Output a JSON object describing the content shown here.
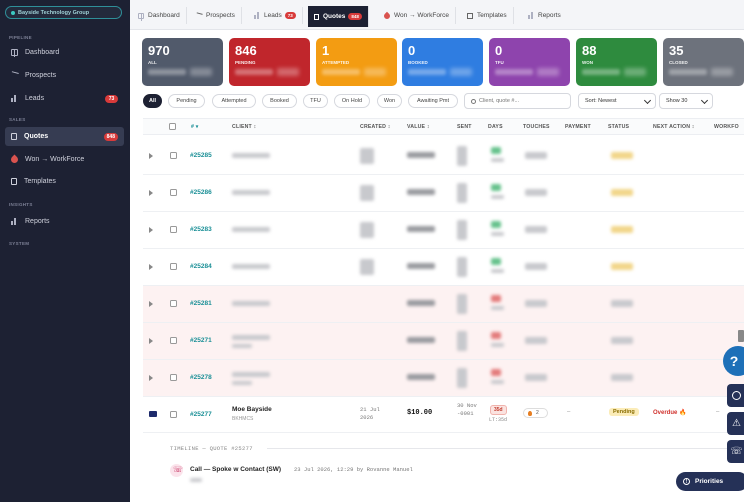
{
  "sidebar": {
    "org": "Bayside Technology Group",
    "sections": {
      "pipeline": "PIPELINE",
      "sales": "SALES",
      "insights": "INSIGHTS",
      "system": "SYSTEM"
    },
    "items": [
      {
        "label": "Dashboard",
        "icon": "grid-icon"
      },
      {
        "label": "Prospects",
        "icon": "prospect-icon"
      },
      {
        "label": "Leads",
        "icon": "leads-icon",
        "badge": "73"
      },
      {
        "label": "Quotes",
        "icon": "document-icon",
        "badge": "848"
      },
      {
        "label": "Won → WorkForce",
        "icon": "rocket-icon"
      },
      {
        "label": "Templates",
        "icon": "template-icon"
      },
      {
        "label": "Reports",
        "icon": "bar-chart-icon"
      }
    ]
  },
  "tabs": [
    {
      "label": "Dashboard"
    },
    {
      "label": "Prospects"
    },
    {
      "label": "Leads",
      "badge": "73"
    },
    {
      "label": "Quotes",
      "badge": "848"
    },
    {
      "label": "Won → WorkForce"
    },
    {
      "label": "Templates"
    },
    {
      "label": "Reports"
    }
  ],
  "stats": [
    {
      "value": "970",
      "label": "ALL",
      "color": "#515a6b"
    },
    {
      "value": "846",
      "label": "PENDING",
      "color": "#c0262c"
    },
    {
      "value": "1",
      "label": "ATTEMPTED",
      "color": "#f39c12"
    },
    {
      "value": "0",
      "label": "BOOKED",
      "color": "#2f7de1"
    },
    {
      "value": "0",
      "label": "TFU",
      "color": "#8e44ad"
    },
    {
      "value": "88",
      "label": "WON",
      "color": "#2e8b3e"
    },
    {
      "value": "35",
      "label": "CLOSED",
      "color": "#6d727c"
    }
  ],
  "filters": [
    "All",
    "Pending",
    "Attempted",
    "Booked",
    "TFU",
    "On Hold",
    "Won",
    "Awaiting Pmt"
  ],
  "search": {
    "placeholder": "Client, quote #..."
  },
  "sort": {
    "value": "Sort: Newest"
  },
  "show": {
    "value": "Show 30"
  },
  "table": {
    "headers": [
      "# ▾",
      "CLIENT ↕",
      "CREATED ↕",
      "VALUE ↕",
      "SENT",
      "DAYS",
      "TOUCHES",
      "PAYMENT",
      "STATUS",
      "NEXT ACTION ↕",
      "WORKFO"
    ],
    "rows": [
      {
        "id": "#25285"
      },
      {
        "id": "#25286"
      },
      {
        "id": "#25283"
      },
      {
        "id": "#25284"
      },
      {
        "id": "#25281"
      },
      {
        "id": "#25271"
      },
      {
        "id": "#25278"
      }
    ],
    "expanded": {
      "id": "#25277",
      "client": "Moe Bayside",
      "client_sub": "BKHMCS",
      "created": "21 Jul 2026",
      "value": "$10.00",
      "sent": "30 Nov -0001",
      "days": "35d",
      "days_sub": "LT:35d",
      "touches": "2",
      "payment": "–",
      "status": "Pending",
      "next_action": "Overdue 🔥",
      "workforce": "–"
    }
  },
  "timeline": {
    "header": "TIMELINE — QUOTE #25277",
    "title": "Call — Spoke w Contact (SW)",
    "meta": "23 Jul 2026, 12:29 by Rovanne Manuel"
  },
  "floating": {
    "help": "?",
    "priorities": "Priorities"
  }
}
